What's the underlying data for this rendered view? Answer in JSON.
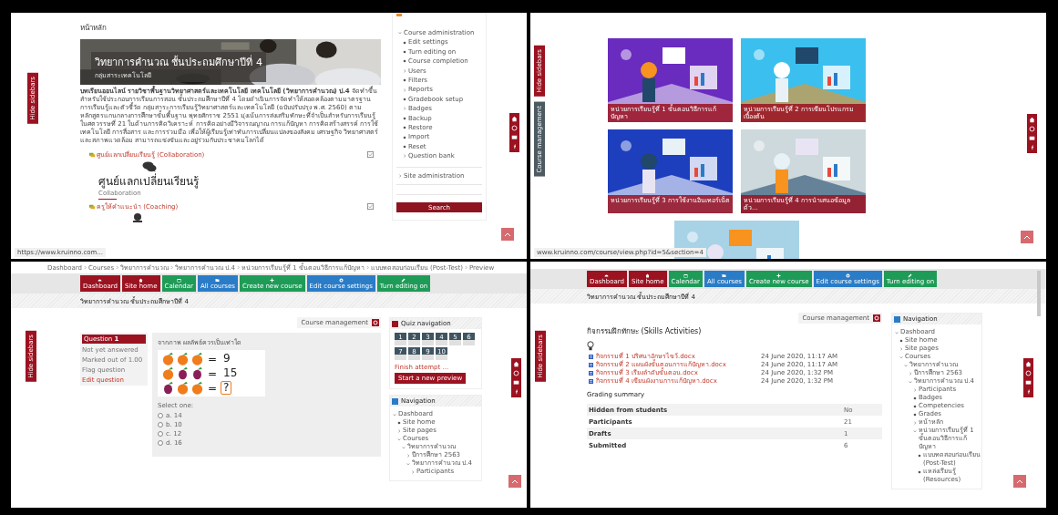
{
  "home_page": {
    "side_tab": "Hide sidebars",
    "page_title": "หน้าหลัก",
    "banner": {
      "title": "วิทยาการคำนวณ ชั้นประถมศึกษาปีที่ 4",
      "subtitle": "กลุ่มสาระเทคโนโลยี"
    },
    "description": "**บทเรียนออนไลน์ รายวิชาพื้นฐานวิทยาศาสตร์และเทคโนโลยี เทคโนโลยี (วิทยาการคำนวณ) ป.4** จัดทำขึ้นสำหรับใช้ประกอบการเรียนการสอน ชั้นประถมศึกษาปีที่ 4 โดยดำเนินการจัดทำให้สอดคล้องตามมาตรฐานการเรียนรู้และตัวชี้วัด กลุ่มสาระการเรียนรู้วิทยาศาสตร์และเทคโนโลยี (ฉบับปรับปรุง พ.ศ. 2560) ตามหลักสูตรแกนกลางการศึกษาขั้นพื้นฐาน พุทธศักราช 2551 มุ่งเน้นการส่งเสริมทักษะที่จำเป็นสำหรับการเรียนรู้ในศตวรรษที่ 21 ในด้านการคิดวิเคราะห์ การคิดอย่างมีวิจารณญาณ การแก้ปัญหา การคิดสร้างสรรค์ การใช้เทคโนโลยี การสื่อสาร และการร่วมมือ เพื่อให้ผู้เรียนรู้เท่าทันการเปลี่ยนแปลงของสังคม เศรษฐกิจ วิทยาศาสตร์ และสภาพแวดล้อม สามารถแข่งขันและอยู่ร่วมกับประชาคมโลกได้",
    "activities": [
      {
        "link": "ศูนย์แลกเปลี่ยนเรียนรู้ (Collaboration)",
        "completed": false,
        "heading": "ศูนย์แลกเปลี่ยนเรียนรู้",
        "subheading": "Collaboration"
      },
      {
        "link": "ครูให้คำแนะนำ (Coaching)",
        "completed": false
      }
    ],
    "status_url": "https://www.kruinno.com...",
    "admin": {
      "items": [
        {
          "label": "Course administration",
          "expanded": true,
          "children": [
            {
              "label": "Edit settings"
            },
            {
              "label": "Turn editing on"
            },
            {
              "label": "Course completion"
            },
            {
              "label": "Users",
              "expanded": false
            },
            {
              "label": "Filters"
            },
            {
              "label": "Reports",
              "expanded": false
            },
            {
              "label": "Gradebook setup"
            },
            {
              "label": "Badges",
              "expanded": false
            },
            {
              "label": "Backup"
            },
            {
              "label": "Restore"
            },
            {
              "label": "Import"
            },
            {
              "label": "Reset"
            },
            {
              "label": "Question bank",
              "expanded": false
            }
          ]
        },
        {
          "label": "Site administration",
          "expanded": false
        }
      ],
      "search_button": "Search"
    }
  },
  "units_page": {
    "side_tabs": [
      "Hide sidebars",
      "Course management"
    ],
    "cards": [
      {
        "title": "หน่วยการเรียนรู้ที่ 1 ขั้นตอนวิธีการแก้ปัญหา"
      },
      {
        "title": "หน่วยการเรียนรู้ที่ 2 การเขียนโปรแกรมเบื้องต้น"
      },
      {
        "title": "หน่วยการเรียนรู้ที่ 3 การใช้งานอินเทอร์เน็ต"
      },
      {
        "title": "หน่วยการเรียนรู้ที่ 4 การนำเสนอข้อมูลด้ว..."
      },
      {
        "kind": "picture"
      }
    ],
    "status_url": "www.kruinno.com/course/view.php?id=5&section=4"
  },
  "quiz_page": {
    "side_tab": "Hide sidebars",
    "breadcrumb": [
      "Dashboard",
      "Courses",
      "วิทยาการคำนวณ",
      "วิทยาการคำนวณ ป.4",
      "หน่วยการเรียนรู้ที่ 1 ขั้นตอนวิธีการแก้ปัญหา",
      "แบบทดสอบก่อนเรียน (Post-Test)",
      "Preview"
    ],
    "toolbar": [
      {
        "label": "Dashboard",
        "color": "#9b1221"
      },
      {
        "label": "Site home",
        "color": "#9b1221"
      },
      {
        "label": "Calendar",
        "color": "#1f9b58"
      },
      {
        "label": "All courses",
        "color": "#2a7cc7"
      },
      {
        "label": "Create new course",
        "color": "#1f9b58"
      },
      {
        "label": "Edit course settings",
        "color": "#2a7cc7"
      },
      {
        "label": "Turn editing on",
        "color": "#1f9b58"
      }
    ],
    "course_title": "วิทยาการคำนวณ ชั้นประถมศึกษาปีที่ 4",
    "course_management": "Course management",
    "question_info": {
      "label": "Question",
      "number": "1",
      "status": "Not yet answered",
      "marks": "Marked out of 1.00",
      "flag": "Flag question",
      "edit": "Edit question"
    },
    "question_text": "จากภาพ ผลลัพธ์ควรเป็นเท่าใด",
    "puzzle": [
      {
        "fruits": [
          {
            "kind": "orange"
          },
          {
            "kind": "orange"
          },
          {
            "kind": "orange"
          }
        ],
        "sign": "=",
        "result": "9",
        "boxed": false
      },
      {
        "fruits": [
          {
            "kind": "orange"
          },
          {
            "kind": "grape"
          },
          {
            "kind": "grape"
          }
        ],
        "sign": "=",
        "result": "15",
        "boxed": false
      },
      {
        "fruits": [
          {
            "kind": "grape"
          },
          {
            "kind": "orange"
          },
          {
            "kind": "orange"
          }
        ],
        "sign": "=",
        "result": "?",
        "boxed": true
      }
    ],
    "prompt": "Select one:",
    "options": [
      {
        "label": "a. 14",
        "selected": false
      },
      {
        "label": "b. 10",
        "selected": false
      },
      {
        "label": "c. 12",
        "selected": false
      },
      {
        "label": "d. 16",
        "selected": false
      }
    ],
    "quiz_navigation": {
      "title": "Quiz navigation",
      "questions": [
        "1",
        "2",
        "3",
        "4",
        "5",
        "6",
        "7",
        "8",
        "9",
        "10"
      ],
      "finish": "Finish attempt ...",
      "restart": "Start a new preview"
    },
    "navigation": {
      "title": "Navigation",
      "items": [
        {
          "label": "Dashboard",
          "expanded": true,
          "children": [
            {
              "label": "Site home"
            },
            {
              "label": "Site pages",
              "expanded": false
            },
            {
              "label": "Courses",
              "expanded": true,
              "children": [
                {
                  "label": "วิทยาการคำนวณ",
                  "expanded": true,
                  "children": [
                    {
                      "label": "ปีการศึกษา 2563",
                      "expanded": false
                    },
                    {
                      "label": "วิทยาการคำนวณ ป.4",
                      "expanded": true,
                      "children": [
                        {
                          "label": "Participants",
                          "expanded": false
                        }
                      ]
                    }
                  ]
                }
              ]
            }
          ]
        }
      ]
    }
  },
  "assignment_page": {
    "side_tab": "Hide sidebars",
    "toolbar": [
      {
        "label": "Dashboard",
        "color": "#9b1221"
      },
      {
        "label": "Site home",
        "color": "#9b1221"
      },
      {
        "label": "Calendar",
        "color": "#1f9b58"
      },
      {
        "label": "All courses",
        "color": "#2a7cc7"
      },
      {
        "label": "Create new course",
        "color": "#1f9b58"
      },
      {
        "label": "Edit course settings",
        "color": "#2a7cc7"
      },
      {
        "label": "Turn editing on",
        "color": "#1f9b58"
      }
    ],
    "course_title": "วิทยาการคำนวณ ชั้นประถมศึกษาปีที่ 4",
    "course_management": "Course management",
    "heading": "กิจกรรมฝึกทักษะ (Skills Activities)",
    "files": [
      {
        "name": "กิจกรรมที่ 1 ปริศนาอักษรไขว้.docx",
        "date": "24 June 2020, 11:17 AM"
      },
      {
        "name": "กิจกรรมที่ 2 แผนผังขั้นตอนการแก้ปัญหา.docx",
        "date": "24 June 2020, 11:17 AM"
      },
      {
        "name": "กิจกรรมที่ 3 เรียงลำดับขั้นตอน.docx",
        "date": "24 June 2020, 1:32 PM"
      },
      {
        "name": "กิจกรรมที่ 4 เขียนผังงานการแก้ปัญหา.docx",
        "date": "24 June 2020, 1:32 PM"
      }
    ],
    "grading_title": "Grading summary",
    "grading": [
      {
        "label": "Hidden from students",
        "value": "No"
      },
      {
        "label": "Participants",
        "value": "21"
      },
      {
        "label": "Drafts",
        "value": "1"
      },
      {
        "label": "Submitted",
        "value": "6"
      }
    ],
    "navigation": {
      "title": "Navigation",
      "items": [
        {
          "label": "Dashboard",
          "expanded": true,
          "children": [
            {
              "label": "Site home"
            },
            {
              "label": "Site pages",
              "expanded": false
            },
            {
              "label": "Courses",
              "expanded": true,
              "children": [
                {
                  "label": "วิทยาการคำนวณ",
                  "expanded": true,
                  "children": [
                    {
                      "label": "ปีการศึกษา 2563",
                      "expanded": false
                    },
                    {
                      "label": "วิทยาการคำนวณ ป.4",
                      "expanded": true,
                      "children": [
                        {
                          "label": "Participants",
                          "expanded": false
                        },
                        {
                          "label": "Badges"
                        },
                        {
                          "label": "Competencies"
                        },
                        {
                          "label": "Grades"
                        },
                        {
                          "label": "หน้าหลัก",
                          "expanded": false
                        },
                        {
                          "label": "หน่วยการเรียนรู้ที่ 1 ขั้นตอนวิธีการแก้ปัญหา",
                          "expanded": true,
                          "children": [
                            {
                              "label": "แบบทดสอบก่อนเรียน (Post-Test)"
                            },
                            {
                              "label": "แหล่งเรียนรู้ (Resources)"
                            }
                          ]
                        }
                      ]
                    }
                  ]
                }
              ]
            }
          ]
        }
      ]
    }
  }
}
